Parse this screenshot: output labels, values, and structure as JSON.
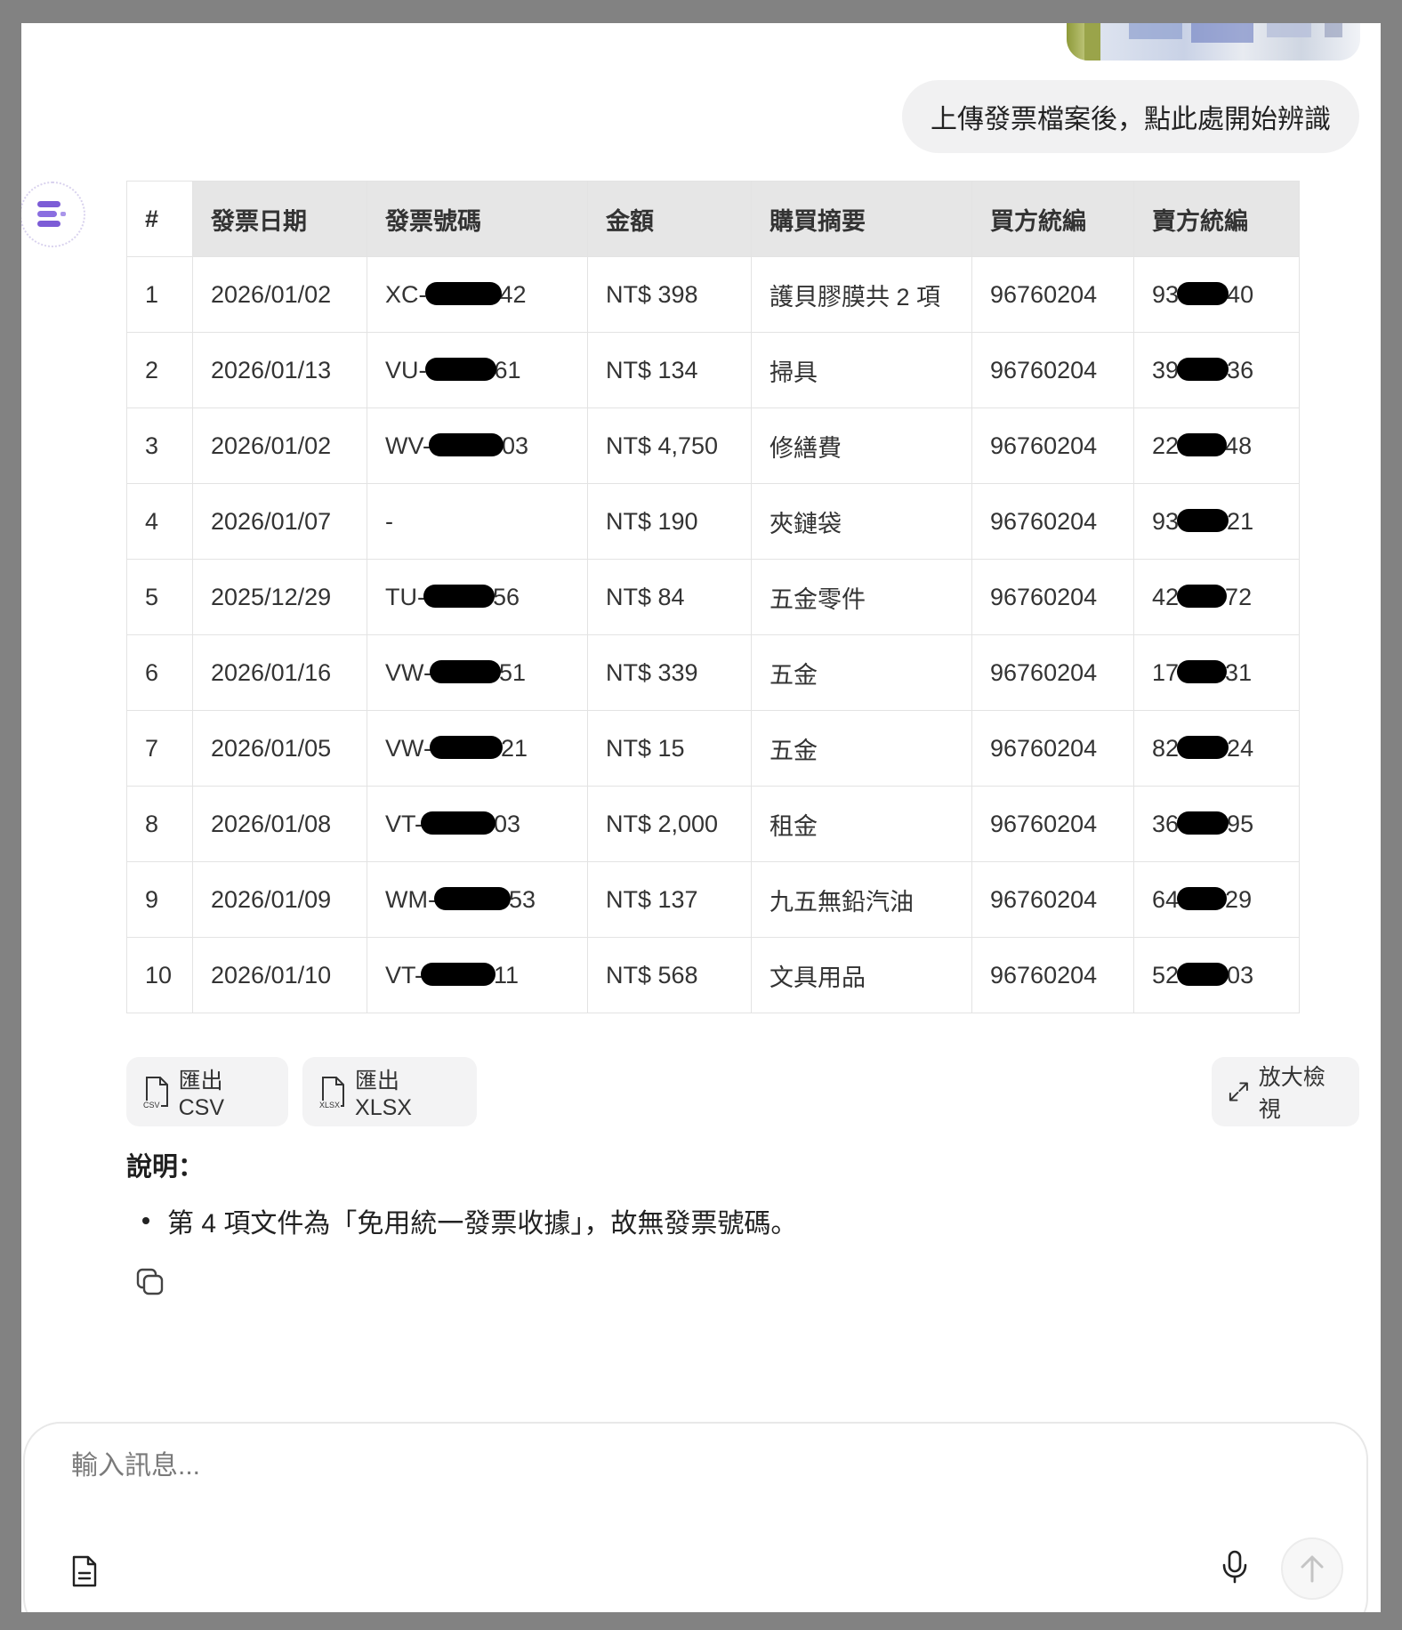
{
  "user_message": "上傳發票檔案後，點此處開始辨識",
  "table": {
    "headers": [
      "#",
      "發票日期",
      "發票號碼",
      "金額",
      "購買摘要",
      "買方統編",
      "賣方統編"
    ],
    "rows": [
      {
        "num": "1",
        "date": "2026/01/02",
        "inv_prefix": "XC-",
        "inv_suffix": "42",
        "amount": "NT$ 398",
        "summary": "護貝膠膜共 2 項",
        "buyer": "96760204",
        "seller_prefix": "93",
        "seller_suffix": "40"
      },
      {
        "num": "2",
        "date": "2026/01/13",
        "inv_prefix": "VU-",
        "inv_suffix": "61",
        "amount": "NT$ 134",
        "summary": "掃具",
        "buyer": "96760204",
        "seller_prefix": "39",
        "seller_suffix": "36"
      },
      {
        "num": "3",
        "date": "2026/01/02",
        "inv_prefix": "WV-",
        "inv_suffix": "03",
        "amount": "NT$ 4,750",
        "summary": "修繕費",
        "buyer": "96760204",
        "seller_prefix": "22",
        "seller_suffix": "48"
      },
      {
        "num": "4",
        "date": "2026/01/07",
        "inv_prefix": "-",
        "inv_suffix": "",
        "amount": "NT$ 190",
        "summary": "夾鏈袋",
        "buyer": "96760204",
        "seller_prefix": "93",
        "seller_suffix": "21"
      },
      {
        "num": "5",
        "date": "2025/12/29",
        "inv_prefix": "TU-",
        "inv_suffix": "56",
        "amount": "NT$ 84",
        "summary": "五金零件",
        "buyer": "96760204",
        "seller_prefix": "42",
        "seller_suffix": "72"
      },
      {
        "num": "6",
        "date": "2026/01/16",
        "inv_prefix": "VW-",
        "inv_suffix": "51",
        "amount": "NT$ 339",
        "summary": "五金",
        "buyer": "96760204",
        "seller_prefix": "17",
        "seller_suffix": "31"
      },
      {
        "num": "7",
        "date": "2026/01/05",
        "inv_prefix": "VW-",
        "inv_suffix": "21",
        "amount": "NT$ 15",
        "summary": "五金",
        "buyer": "96760204",
        "seller_prefix": "82",
        "seller_suffix": "24"
      },
      {
        "num": "8",
        "date": "2026/01/08",
        "inv_prefix": "VT-",
        "inv_suffix": "03",
        "amount": "NT$ 2,000",
        "summary": "租金",
        "buyer": "96760204",
        "seller_prefix": "36",
        "seller_suffix": "95"
      },
      {
        "num": "9",
        "date": "2026/01/09",
        "inv_prefix": "WM-",
        "inv_suffix": "53",
        "amount": "NT$ 137",
        "summary": "九五無鉛汽油",
        "buyer": "96760204",
        "seller_prefix": "64",
        "seller_suffix": "29"
      },
      {
        "num": "10",
        "date": "2026/01/10",
        "inv_prefix": "VT-",
        "inv_suffix": "11",
        "amount": "NT$ 568",
        "summary": "文具用品",
        "buyer": "96760204",
        "seller_prefix": "52",
        "seller_suffix": "03"
      }
    ]
  },
  "actions": {
    "export_csv": "匯出 CSV",
    "export_xlsx": "匯出 XLSX",
    "expand_view": "放大檢視",
    "csv_tag": "CSV",
    "xlsx_tag": "XLSX"
  },
  "note": {
    "title": "說明：",
    "items": [
      "第 4 項文件為「免用統一發票收據」，故無發票號碼。"
    ]
  },
  "composer": {
    "placeholder": "輸入訊息..."
  },
  "icons": {
    "avatar": "brand-logo-icon",
    "export_csv": "csv-file-icon",
    "export_xlsx": "xlsx-file-icon",
    "expand": "expand-arrows-icon",
    "copy": "copy-icon",
    "attach": "document-icon",
    "mic": "microphone-icon",
    "send": "arrow-up-icon"
  },
  "colors": {
    "brand": "#7c5cd6",
    "header_bg": "#e6e6e6",
    "bubble_bg": "#f1f1f2"
  }
}
